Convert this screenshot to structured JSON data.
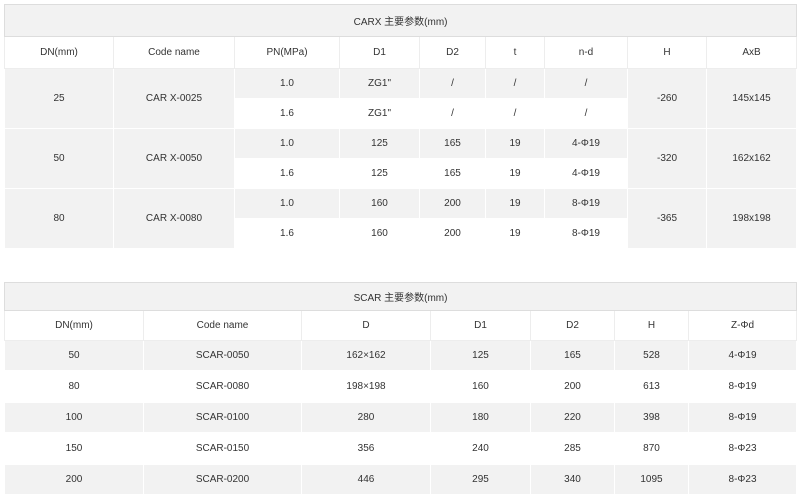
{
  "carx": {
    "title": "CARX 主要参数(mm)",
    "headers": [
      "DN(mm)",
      "Code name",
      "PN(MPa)",
      "D1",
      "D2",
      "t",
      "n-d",
      "H",
      "AxB"
    ],
    "groups": [
      {
        "dn": "25",
        "code": "CAR X-0025",
        "h": "-260",
        "axb": "145x145",
        "rows": [
          {
            "pn": "1.0",
            "d1": "ZG1\"",
            "d2": "/",
            "t": "/",
            "nd": "/"
          },
          {
            "pn": "1.6",
            "d1": "ZG1\"",
            "d2": "/",
            "t": "/",
            "nd": "/"
          }
        ]
      },
      {
        "dn": "50",
        "code": "CAR X-0050",
        "h": "-320",
        "axb": "162x162",
        "rows": [
          {
            "pn": "1.0",
            "d1": "125",
            "d2": "165",
            "t": "19",
            "nd": "4-Φ19"
          },
          {
            "pn": "1.6",
            "d1": "125",
            "d2": "165",
            "t": "19",
            "nd": "4-Φ19"
          }
        ]
      },
      {
        "dn": "80",
        "code": "CAR X-0080",
        "h": "-365",
        "axb": "198x198",
        "rows": [
          {
            "pn": "1.0",
            "d1": "160",
            "d2": "200",
            "t": "19",
            "nd": "8-Φ19"
          },
          {
            "pn": "1.6",
            "d1": "160",
            "d2": "200",
            "t": "19",
            "nd": "8-Φ19"
          }
        ]
      }
    ]
  },
  "scar": {
    "title": "SCAR 主要参数(mm)",
    "headers": [
      "DN(mm)",
      "Code name",
      "D",
      "D1",
      "D2",
      "H",
      "Z-Φd"
    ],
    "rows": [
      [
        "50",
        "SCAR-0050",
        "162×162",
        "125",
        "165",
        "528",
        "4-Φ19"
      ],
      [
        "80",
        "SCAR-0080",
        "198×198",
        "160",
        "200",
        "613",
        "8-Φ19"
      ],
      [
        "100",
        "SCAR-0100",
        "280",
        "180",
        "220",
        "398",
        "8-Φ19"
      ],
      [
        "150",
        "SCAR-0150",
        "356",
        "240",
        "285",
        "870",
        "8-Φ23"
      ],
      [
        "200",
        "SCAR-0200",
        "446",
        "295",
        "340",
        "1095",
        "8-Φ23"
      ]
    ]
  }
}
